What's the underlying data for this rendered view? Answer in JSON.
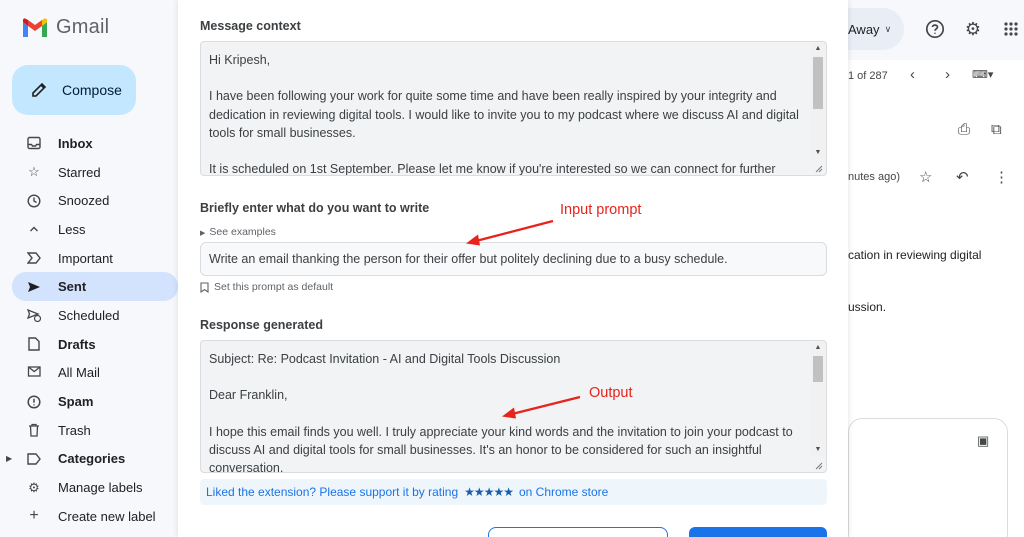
{
  "app": {
    "name": "Gmail"
  },
  "sidebar": {
    "compose_label": "Compose",
    "items": [
      {
        "label": "Inbox",
        "icon": "inbox-icon",
        "bold": true
      },
      {
        "label": "Starred",
        "icon": "star-icon"
      },
      {
        "label": "Snoozed",
        "icon": "clock-icon"
      },
      {
        "label": "Less",
        "icon": "chevron-up-icon"
      },
      {
        "label": "Important",
        "icon": "important-icon"
      },
      {
        "label": "Sent",
        "icon": "send-icon",
        "bold": true,
        "active": true
      },
      {
        "label": "Scheduled",
        "icon": "scheduled-send-icon"
      },
      {
        "label": "Drafts",
        "icon": "draft-icon",
        "bold": true
      },
      {
        "label": "All Mail",
        "icon": "all-mail-icon"
      },
      {
        "label": "Spam",
        "icon": "spam-icon",
        "bold": true
      },
      {
        "label": "Trash",
        "icon": "trash-icon"
      },
      {
        "label": "Categories",
        "icon": "label-icon",
        "bold": true
      },
      {
        "label": "Manage labels",
        "icon": "gear-icon"
      },
      {
        "label": "Create new label",
        "icon": "plus-icon"
      }
    ]
  },
  "header": {
    "status_label": "Away",
    "pager_text": "1 of 287"
  },
  "reading_pane": {
    "time_text": "nutes ago)",
    "snippet_1": "cation in reviewing digital",
    "snippet_2": "ussion."
  },
  "modal": {
    "context_title": "Message context",
    "context_paragraphs": [
      "Hi Kripesh,",
      "I have been following your work for quite some time and have been really inspired by your integrity and dedication in reviewing digital tools. I would like to invite you to my podcast where we discuss AI and digital tools for small businesses.",
      "It is scheduled on 1st September. Please let me know if you're interested so we can connect for further"
    ],
    "prompt_title": "Briefly enter what do you want to write",
    "see_examples": "See examples",
    "prompt_value": "Write an email thanking the person for their offer but politely declining due to a busy schedule.",
    "set_default": "Set this prompt as default",
    "response_title": "Response generated",
    "response_paragraphs": [
      "Subject: Re: Podcast Invitation - AI and Digital Tools Discussion",
      "Dear Franklin,",
      "I hope this email finds you well. I truly appreciate your kind words and the invitation to join your podcast to discuss AI and digital tools for small businesses. It's an honor to be considered for such an insightful conversation."
    ],
    "rating_prefix": "Liked the extension? Please support it by rating",
    "rating_stars": "★★★★★",
    "rating_suffix": "on Chrome store"
  },
  "annotations": {
    "input_label": "Input prompt",
    "output_label": "Output",
    "color": "#e8231c"
  },
  "colors": {
    "accent": "#1a73e8",
    "compose_bg": "#c2e7ff",
    "active_nav": "#d3e3fd"
  }
}
